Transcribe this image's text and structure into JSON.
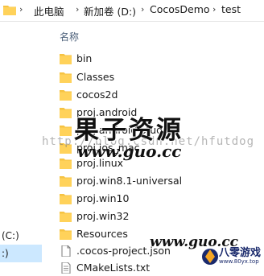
{
  "address_bar": {
    "breadcrumbs": [
      "此电脑",
      "新加卷 (D:)",
      "CocosDemo",
      "test"
    ]
  },
  "nav_pane": {
    "items": [
      {
        "label": "(C:)",
        "selected": false
      },
      {
        "label": ":)",
        "selected": true
      }
    ]
  },
  "file_list": {
    "column_header": "名称",
    "items": [
      {
        "name": "bin",
        "type": "folder"
      },
      {
        "name": "Classes",
        "type": "folder"
      },
      {
        "name": "cocos2d",
        "type": "folder"
      },
      {
        "name": "proj.android",
        "type": "folder"
      },
      {
        "name": "proj.android-studio",
        "type": "folder"
      },
      {
        "name": "proj.ios_mac",
        "type": "folder"
      },
      {
        "name": "proj.linux",
        "type": "folder"
      },
      {
        "name": "proj.win8.1-universal",
        "type": "folder"
      },
      {
        "name": "proj.win10",
        "type": "folder"
      },
      {
        "name": "proj.win32",
        "type": "folder"
      },
      {
        "name": "Resources",
        "type": "folder"
      },
      {
        "name": ".cocos-project.json",
        "type": "file"
      },
      {
        "name": "CMakeLists.txt",
        "type": "file"
      }
    ]
  },
  "watermarks": {
    "main": "果子资源",
    "url": "www.guo.cc",
    "csdn": "http://blog.csdn.net/hfutdog",
    "bottom_url": "www.guo.cc",
    "logo_text": "八零游戏",
    "logo_sub": "www.80yx.top"
  },
  "colors": {
    "folder": "#f6c342",
    "selection": "#cce8ff",
    "header_text": "#4c607a"
  }
}
